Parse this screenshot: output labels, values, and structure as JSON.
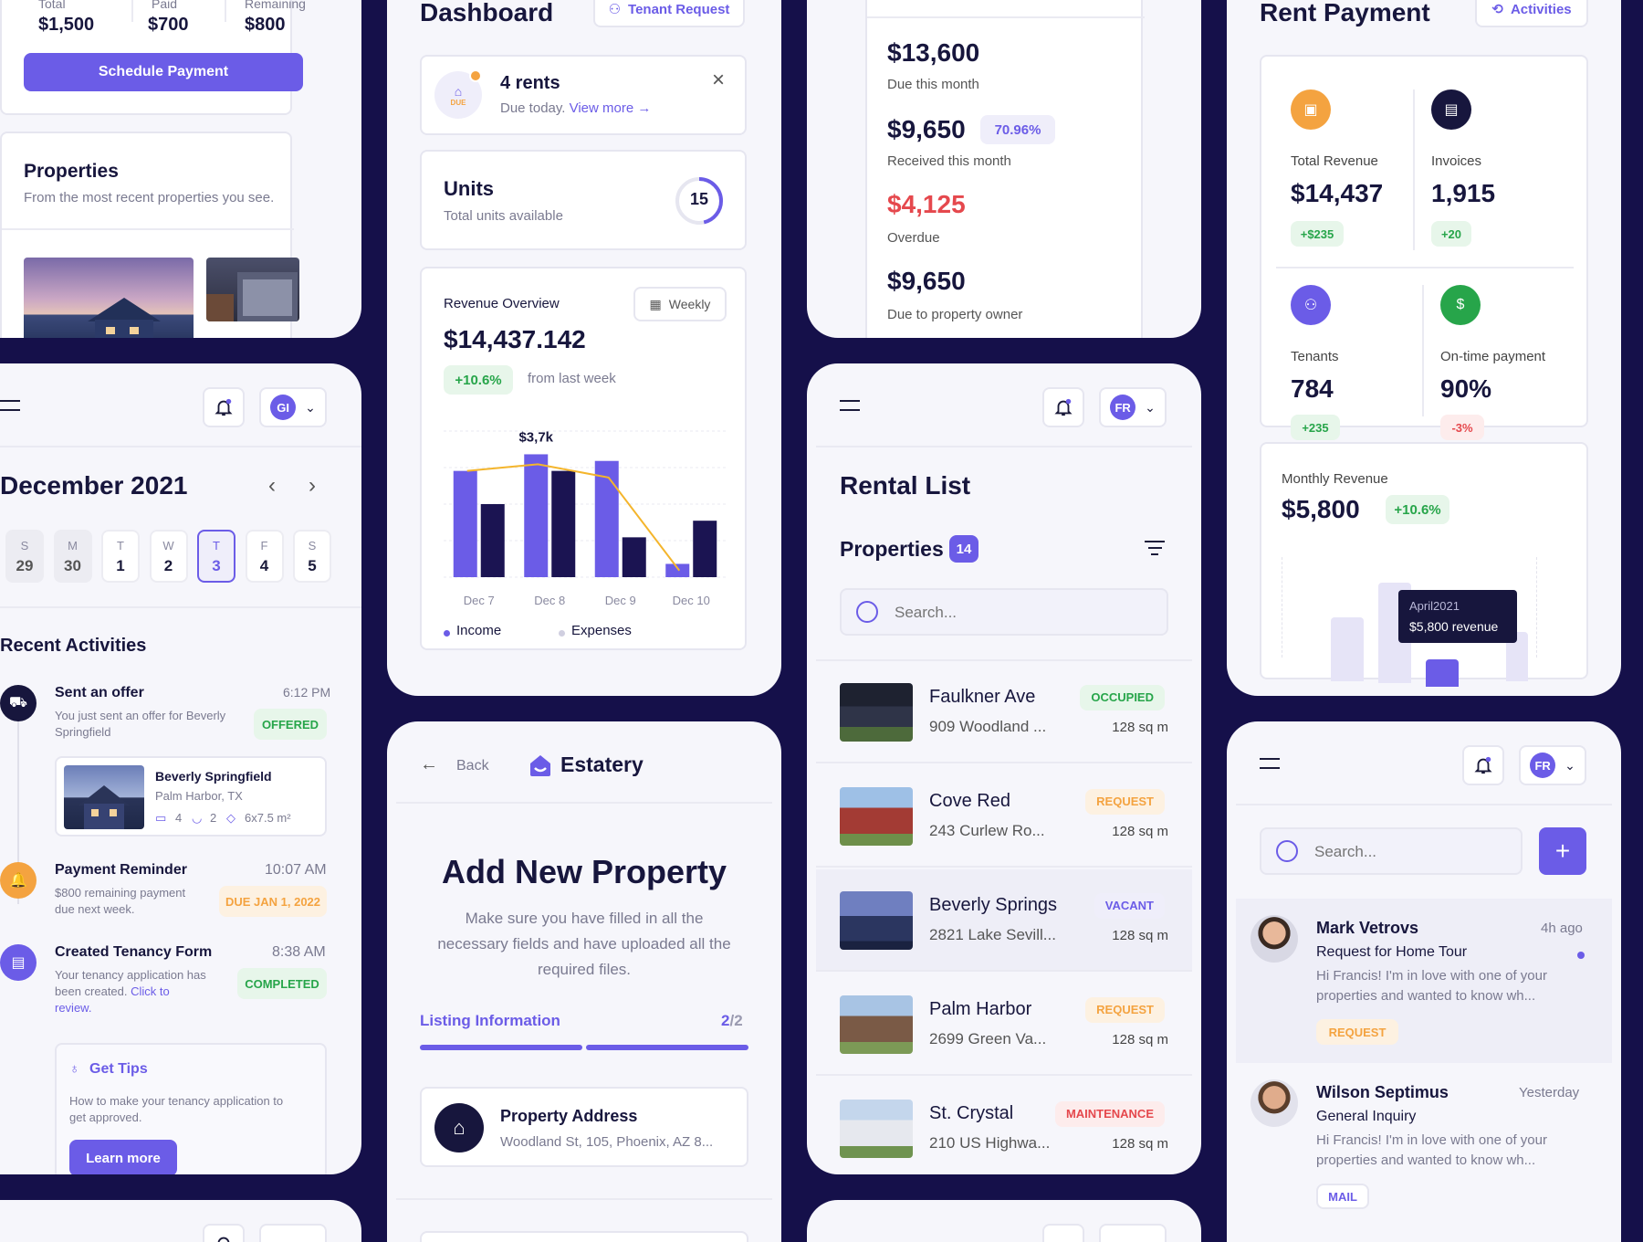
{
  "top_left": {
    "col_total": "Total",
    "col_paid": "Paid",
    "col_remaining": "Remaining",
    "total": "$1,500",
    "paid": "$700",
    "remaining": "$800",
    "schedule_button": "Schedule Payment",
    "properties_title": "Properties",
    "properties_subtitle": "From the most recent properties you see."
  },
  "calendar": {
    "avatar": "GI",
    "month": "December 2021",
    "days": [
      {
        "dow": "S",
        "num": "29"
      },
      {
        "dow": "M",
        "num": "30"
      },
      {
        "dow": "T",
        "num": "1"
      },
      {
        "dow": "W",
        "num": "2"
      },
      {
        "dow": "T",
        "num": "3"
      },
      {
        "dow": "F",
        "num": "4"
      },
      {
        "dow": "S",
        "num": "5"
      }
    ],
    "recent_title": "Recent Activities",
    "activities": [
      {
        "title": "Sent an offer",
        "time": "6:12 PM",
        "desc1": "You just sent an offer for Beverly",
        "desc2": "Springfield",
        "badge": "OFFERED"
      },
      {
        "title": "Payment Reminder",
        "time": "10:07 AM",
        "desc1": "$800 remaining payment",
        "desc2": "due next week.",
        "badge": "DUE JAN 1, 2022"
      },
      {
        "title": "Created Tenancy Form",
        "time": "8:38 AM",
        "desc1": "Your tenancy application has",
        "desc2": "been created.",
        "link1": "Click to",
        "link2": "review.",
        "badge": "COMPLETED"
      }
    ],
    "offer_card": {
      "name": "Beverly Springfield",
      "location": "Palm Harbor, TX",
      "beds": "4",
      "baths": "2",
      "size": "6x7.5 m²"
    },
    "tips_title": "Get Tips",
    "tips_text1": "How to make your tenancy application to",
    "tips_text2": "get approved.",
    "tips_button": "Learn more"
  },
  "dashboard": {
    "title": "Dashboard",
    "tenant_request": "Tenant Request",
    "notice_badge": "DUE",
    "notice_title": "4 rents",
    "notice_text": "Due today.",
    "notice_link": "View more →",
    "units_title": "Units",
    "units_sub": "Total units available",
    "units_count": "15",
    "revenue_title": "Revenue Overview",
    "period": "Weekly",
    "revenue_value": "$14,437.142",
    "change": "+10.6%",
    "change_note": "from last week",
    "legend_income": "Income",
    "legend_expenses": "Expenses",
    "peak_label": "$3,7k"
  },
  "chart_data": {
    "type": "bar",
    "categories": [
      "Dec 7",
      "Dec 8",
      "Dec 9",
      "Dec 10"
    ],
    "series": [
      {
        "name": "Income",
        "values": [
          3.2,
          3.7,
          3.5,
          0.4
        ]
      },
      {
        "name": "Expenses",
        "values": [
          2.2,
          3.2,
          1.2,
          1.7
        ]
      }
    ],
    "line_values": [
      3.2,
      3.4,
      3.0,
      0.2
    ],
    "ylim": [
      0,
      4.4
    ],
    "grid": true,
    "legend": "bottom",
    "colors": {
      "Income": "#6b5ce7",
      "Expenses": "#1b1452",
      "line": "#f4b52c"
    }
  },
  "add_property": {
    "back": "Back",
    "brand": "Estatery",
    "title": "Add New Property",
    "desc1": "Make sure you have filled in all the",
    "desc2": "necessary fields and have uploaded all the",
    "desc3": "required files.",
    "step_label": "Listing Information",
    "step_current": "2",
    "step_total": "/2",
    "address_title": "Property Address",
    "address_value": "Woodland St, 105, Phoenix, AZ 8..."
  },
  "rent_summary": {
    "due_value": "$13,600",
    "due_label": "Due this month",
    "received_value": "$9,650",
    "received_pct": "70.96%",
    "received_label": "Received this month",
    "overdue_value": "$4,125",
    "overdue_label": "Overdue",
    "owner_value": "$9,650",
    "owner_label": "Due to property owner"
  },
  "rental_list": {
    "avatar": "FR",
    "title": "Rental List",
    "properties_label": "Properties",
    "count": "14",
    "search_placeholder": "Search...",
    "items": [
      {
        "name": "Faulkner Ave",
        "address": "909 Woodland ...",
        "status": "OCCUPIED",
        "size": "128 sq m"
      },
      {
        "name": "Cove Red",
        "address": "243 Curlew Ro...",
        "status": "REQUEST",
        "size": "128 sq m"
      },
      {
        "name": "Beverly Springs",
        "address": "2821 Lake Sevill...",
        "status": "VACANT",
        "size": "128 sq m"
      },
      {
        "name": "Palm Harbor",
        "address": "2699 Green Va...",
        "status": "REQUEST",
        "size": "128 sq m"
      },
      {
        "name": "St. Crystal",
        "address": "210 US Highwa...",
        "status": "MAINTENANCE",
        "size": "128 sq m"
      }
    ]
  },
  "rent_payment": {
    "title": "Rent Payment",
    "activities": "Activities",
    "stats": [
      {
        "label": "Total Revenue",
        "value": "$14,437",
        "delta": "+$235"
      },
      {
        "label": "Invoices",
        "value": "1,915",
        "delta": "+20"
      },
      {
        "label": "Tenants",
        "value": "784",
        "delta": "+235"
      },
      {
        "label": "On-time payment",
        "value": "90%",
        "delta": "-3%"
      }
    ],
    "monthly_title": "Monthly Revenue",
    "monthly_value": "$5,800",
    "monthly_change": "+10.6%",
    "tooltip_month": "April2021",
    "tooltip_value": "$5,800 revenue"
  },
  "messages": {
    "avatar": "FR",
    "search_placeholder": "Search...",
    "items": [
      {
        "name": "Mark Vetrovs",
        "time": "4h ago",
        "subject": "Request for Home Tour",
        "body1": "Hi Francis! I'm in love with one of your",
        "body2": "properties and wanted to know wh...",
        "tag": "REQUEST"
      },
      {
        "name": "Wilson Septimus",
        "time": "Yesterday",
        "subject": "General Inquiry",
        "body1": "Hi Francis! I'm in love with one of your",
        "body2": "properties and wanted to know wh...",
        "tag": "MAIL"
      }
    ]
  },
  "colors": {
    "accent": "#6b5ce7",
    "navy": "#15104a",
    "green": "#27a54a",
    "red": "#e5484d",
    "orange": "#f4a340"
  }
}
